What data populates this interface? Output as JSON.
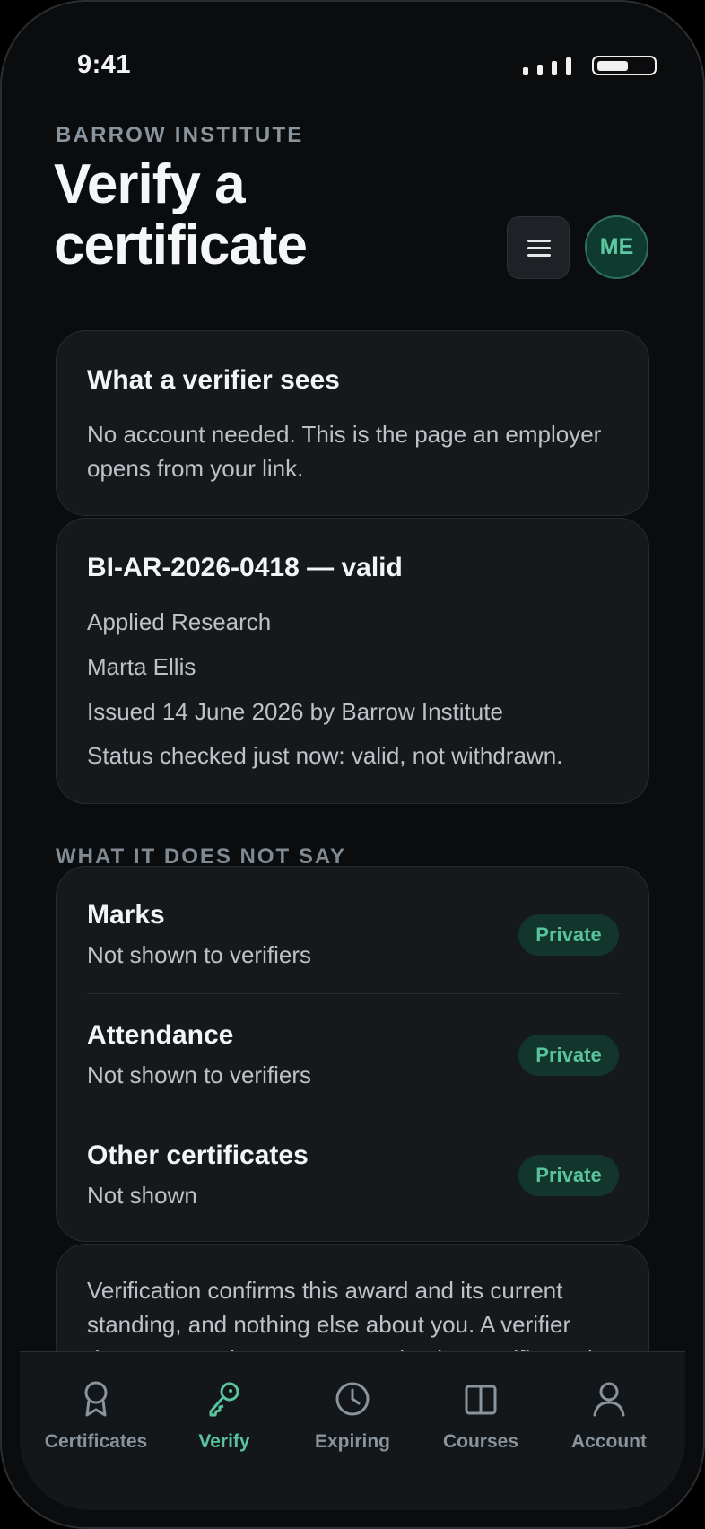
{
  "status_bar": {
    "time": "9:41"
  },
  "header": {
    "brand": "BARROW INSTITUTE",
    "title": "Verify a certificate",
    "avatar_initials": "ME"
  },
  "verifier_card": {
    "title": "What a verifier sees",
    "text": "No account needed. This is the page an employer opens from your link."
  },
  "certificate_card": {
    "title": "BI-AR-2026-0418 — valid",
    "lines": [
      "Applied Research",
      "Marta Ellis",
      "Issued 14 June 2026 by Barrow Institute",
      "Status checked just now: valid, not withdrawn."
    ]
  },
  "privacy": {
    "section_label": "WHAT IT DOES NOT SAY",
    "rows": [
      {
        "title": "Marks",
        "sub": "Not shown to verifiers",
        "badge": "Private"
      },
      {
        "title": "Attendance",
        "sub": "Not shown to verifiers",
        "badge": "Private"
      },
      {
        "title": "Other certificates",
        "sub": "Not shown",
        "badge": "Private"
      }
    ]
  },
  "note_card": {
    "text": "Verification confirms this award and its current standing, and nothing else about you. A verifier does not need an account to check a certificate, is"
  },
  "tabbar": {
    "tabs": [
      {
        "label": "Certificates",
        "icon": "award-icon",
        "active": false
      },
      {
        "label": "Verify",
        "icon": "key-icon",
        "active": true
      },
      {
        "label": "Expiring",
        "icon": "clock-icon",
        "active": false
      },
      {
        "label": "Courses",
        "icon": "book-icon",
        "active": false
      },
      {
        "label": "Account",
        "icon": "user-icon",
        "active": false
      }
    ]
  },
  "colors": {
    "background": "#0b0c0e",
    "card": "#16191c",
    "accent": "#58c39c",
    "badge_bg": "#12362b"
  }
}
